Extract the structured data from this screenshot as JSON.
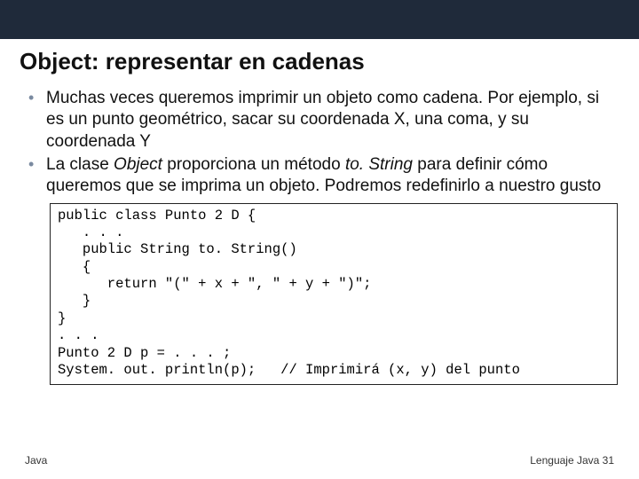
{
  "header": {
    "title": "Object: representar en cadenas"
  },
  "bullets": [
    {
      "text": "Muchas veces queremos imprimir un objeto como cadena. Por ejemplo, si es un punto geométrico, sacar su coordenada X, una coma, y su coordenada Y"
    },
    {
      "prefix": "La clase ",
      "em1": "Object",
      "mid": " proporciona un método ",
      "em2": "to. String",
      "suffix": " para definir cómo queremos que se imprima un objeto. Podremos redefinirlo a nuestro gusto"
    }
  ],
  "code": "public class Punto 2 D {\n   . . .\n   public String to. String()\n   {\n      return \"(\" + x + \", \" + y + \")\";\n   }\n}\n. . .\nPunto 2 D p = . . . ;\nSystem. out. println(p);   // Imprimirá (x, y) del punto",
  "footer": {
    "left": "Java",
    "right": "Lenguaje Java 31"
  }
}
